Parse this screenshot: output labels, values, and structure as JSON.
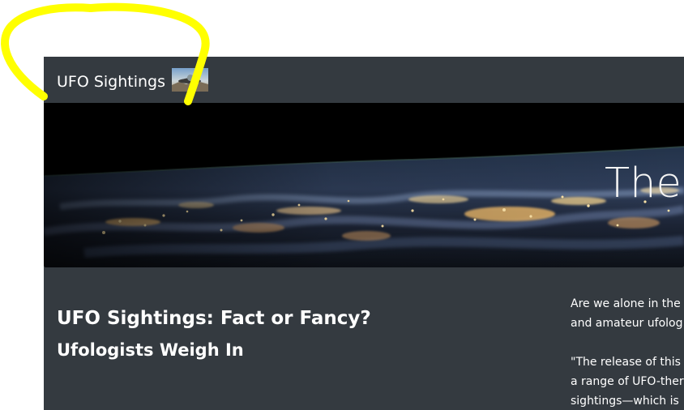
{
  "navbar": {
    "brand": "UFO Sightings",
    "thumbnail_icon": "ufo-thumbnail-icon"
  },
  "hero": {
    "title": "The"
  },
  "article": {
    "title": "UFO Sightings: Fact or Fancy?",
    "subtitle": "Ufologists Weigh In",
    "paragraphs": [
      [
        "Are we alone in the",
        "and amateur ufolog"
      ],
      [
        "\"The release of this a",
        "a range of UFO-ther",
        "sightings—which is"
      ]
    ]
  },
  "colors": {
    "page_background": "#ffffff",
    "site_background": "#343a40",
    "hero_background": "#000000",
    "text": "#ffffff",
    "annotation": "#ffff00"
  }
}
